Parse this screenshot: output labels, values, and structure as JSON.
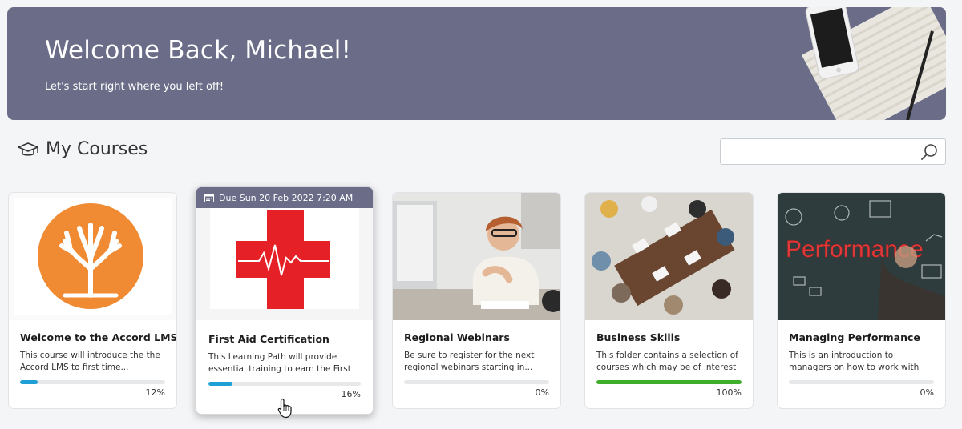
{
  "hero": {
    "title": "Welcome Back, Michael!",
    "subtitle": "Let's start right where you left off!",
    "background": "#6b6d88"
  },
  "section": {
    "title": "My Courses",
    "icon": "graduation-cap-icon"
  },
  "search": {
    "value": "",
    "placeholder": "",
    "icon": "search-icon"
  },
  "courses": [
    {
      "title": "Welcome to the Accord LMS",
      "description": "This course will introduce the the Accord LMS to first time...",
      "progress": 12,
      "progress_label": "12%",
      "progress_color": "#1e9fd6",
      "thumbnail": "orange-tree-logo"
    },
    {
      "title": "First Aid Certification",
      "description": "This Learning Path will provide essential training to earn the First Ai...",
      "progress": 16,
      "progress_label": "16%",
      "progress_color": "#1e9fd6",
      "due": "Due Sun 20 Feb 2022 7:20 AM",
      "thumbnail": "red-cross-heartbeat"
    },
    {
      "title": "Regional Webinars",
      "description": "Be sure to register for the next regional webinars starting in...",
      "progress": 0,
      "progress_label": "0%",
      "progress_color": "#1e9fd6",
      "thumbnail": "woman-at-computer-photo"
    },
    {
      "title": "Business Skills",
      "description": "This folder contains a selection of courses which may be of interest to...",
      "progress": 100,
      "progress_label": "100%",
      "progress_color": "#3fae2a",
      "thumbnail": "team-meeting-photo"
    },
    {
      "title": "Managing Performance",
      "description": "This is an introduction to managers on how to work with their employee...",
      "progress": 0,
      "progress_label": "0%",
      "progress_color": "#1e9fd6",
      "thumbnail": "performance-chalkboard-photo",
      "thumbnail_text": "Performance"
    }
  ]
}
